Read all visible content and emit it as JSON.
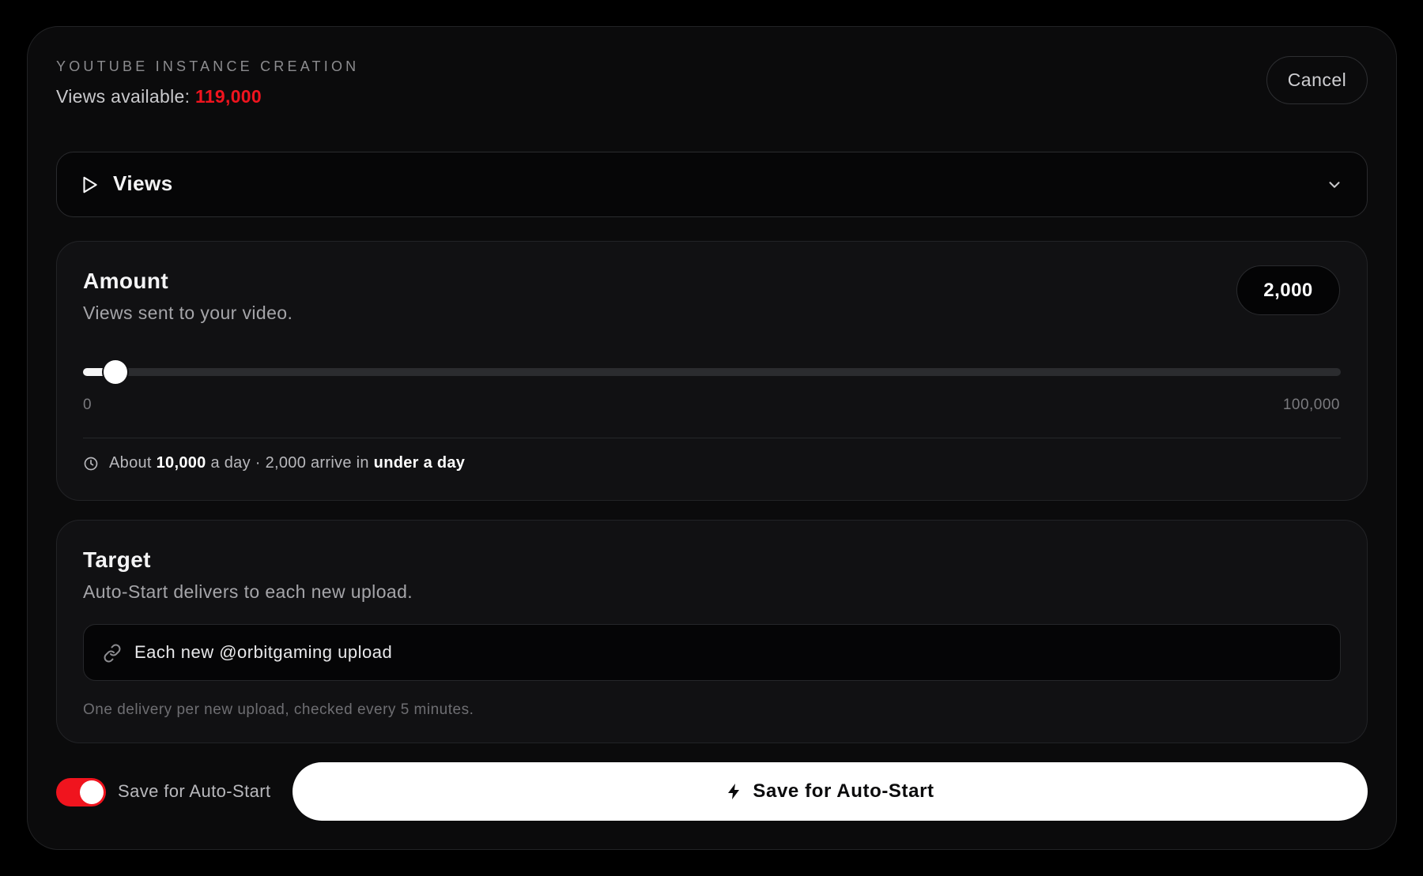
{
  "header": {
    "title": "YOUTUBE INSTANCE CREATION",
    "views_available_label": "Views available:",
    "views_available_value": "119,000",
    "cancel_label": "Cancel"
  },
  "service": {
    "selected": "Views",
    "icon": "play-icon"
  },
  "amount": {
    "title": "Amount",
    "subtitle": "Views sent to your video.",
    "value_display": "2,000",
    "value": 2000,
    "min": 0,
    "max": 100000,
    "min_label": "0",
    "max_label": "100,000",
    "eta": {
      "prefix": "About",
      "per_day": "10,000",
      "middle": "a day · 2,000 arrive in",
      "duration": "under a day"
    }
  },
  "target": {
    "title": "Target",
    "subtitle": "Auto-Start delivers to each new upload.",
    "input_value": "Each new @orbitgaming upload",
    "note": "One delivery per new upload, checked every 5 minutes."
  },
  "footer": {
    "toggle_on": true,
    "toggle_label": "Save for Auto-Start",
    "save_label": "Save for Auto-Start"
  },
  "colors": {
    "accent": "#f0141e",
    "background": "#000000",
    "modal": "#0b0b0c",
    "card": "#111113"
  }
}
